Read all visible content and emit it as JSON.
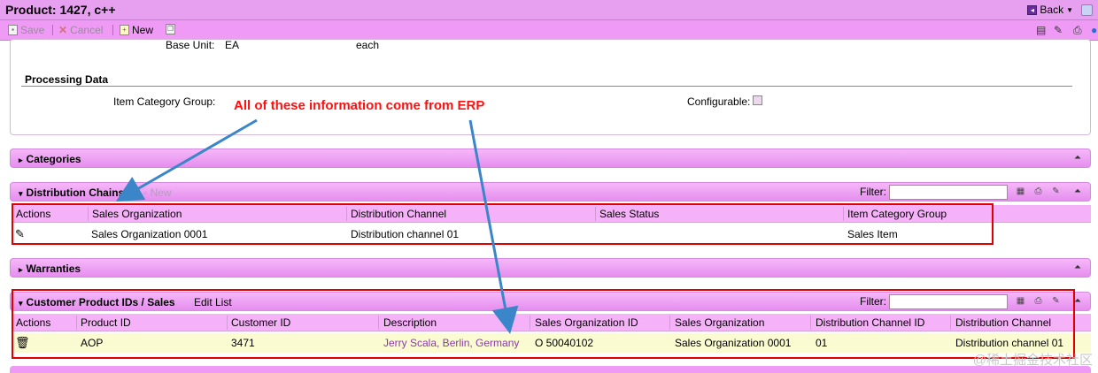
{
  "window": {
    "title": "Product: 1427, c++",
    "back_label": "Back"
  },
  "toolbar": {
    "save": "Save",
    "cancel": "Cancel",
    "new": "New"
  },
  "base": {
    "label": "Base Unit:",
    "value": "EA",
    "desc": "each"
  },
  "processing": {
    "title": "Processing Data",
    "item_category_label": "Item Category Group:",
    "configurable_label": "Configurable:"
  },
  "annotation": "All of these information come from ERP",
  "categories": {
    "title": "Categories"
  },
  "distribution": {
    "title": "Distribution Chains",
    "new_label": "New",
    "filter_label": "Filter:",
    "columns": [
      "Actions",
      "Sales Organization",
      "Distribution Channel",
      "Sales Status",
      "Item Category Group"
    ],
    "rows": [
      {
        "sales_org": "Sales Organization 0001",
        "channel": "Distribution channel 01",
        "status": "",
        "item_cat": "Sales Item"
      }
    ]
  },
  "warranties": {
    "title": "Warranties"
  },
  "customer": {
    "title": "Customer Product IDs / Sales",
    "edit_list": "Edit List",
    "filter_label": "Filter:",
    "columns": [
      "Actions",
      "Product ID",
      "Customer ID",
      "Description",
      "Sales Organization ID",
      "Sales Organization",
      "Distribution Channel ID",
      "Distribution Channel"
    ],
    "rows": [
      {
        "product_id": "AOP",
        "customer_id": "3471",
        "description": "Jerry Scala, Berlin, Germany",
        "sales_org_id": "O 50040102",
        "sales_org": "Sales Organization 0001",
        "channel_id": "01",
        "channel": "Distribution channel 01"
      }
    ]
  },
  "watermark": "@稀土掘金技术社区",
  "colors": {
    "accent": "#ef9bf6",
    "annotation_red": "#ff1010",
    "link": "#8a3aa8"
  }
}
